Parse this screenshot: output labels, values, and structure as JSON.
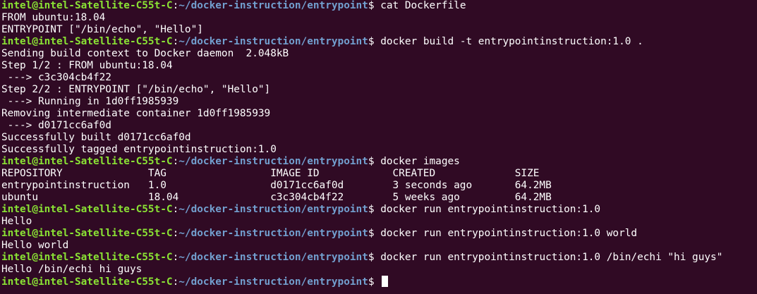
{
  "colors": {
    "background": "#300a24",
    "user_host": "#8ae234",
    "path": "#729fcf",
    "text": "#ffffff"
  },
  "prompt": {
    "user_host": "intel@intel-Satellite-C55t-C",
    "separator": ":",
    "path": "~/docker-instruction/entrypoint",
    "symbol": "$ "
  },
  "lines": [
    {
      "type": "prompt",
      "cmd": "cat Dockerfile"
    },
    {
      "type": "out",
      "text": "FROM ubuntu:18.04"
    },
    {
      "type": "out",
      "text": "ENTRYPOINT [\"/bin/echo\", \"Hello\"]"
    },
    {
      "type": "prompt",
      "cmd": "docker build -t entrypointinstruction:1.0 ."
    },
    {
      "type": "out",
      "text": "Sending build context to Docker daemon  2.048kB"
    },
    {
      "type": "out",
      "text": "Step 1/2 : FROM ubuntu:18.04"
    },
    {
      "type": "out",
      "text": " ---> c3c304cb4f22"
    },
    {
      "type": "out",
      "text": "Step 2/2 : ENTRYPOINT [\"/bin/echo\", \"Hello\"]"
    },
    {
      "type": "out",
      "text": " ---> Running in 1d0ff1985939"
    },
    {
      "type": "out",
      "text": "Removing intermediate container 1d0ff1985939"
    },
    {
      "type": "out",
      "text": " ---> d0171cc6af0d"
    },
    {
      "type": "out",
      "text": "Successfully built d0171cc6af0d"
    },
    {
      "type": "out",
      "text": "Successfully tagged entrypointinstruction:1.0"
    },
    {
      "type": "prompt",
      "cmd": "docker images"
    },
    {
      "type": "out",
      "text": "REPOSITORY              TAG                 IMAGE ID            CREATED             SIZE"
    },
    {
      "type": "out",
      "text": "entrypointinstruction   1.0                 d0171cc6af0d        3 seconds ago       64.2MB"
    },
    {
      "type": "out",
      "text": "ubuntu                  18.04               c3c304cb4f22        5 weeks ago         64.2MB"
    },
    {
      "type": "prompt",
      "cmd": "docker run entrypointinstruction:1.0"
    },
    {
      "type": "out",
      "text": "Hello"
    },
    {
      "type": "prompt",
      "cmd": "docker run entrypointinstruction:1.0 world"
    },
    {
      "type": "out",
      "text": "Hello world"
    },
    {
      "type": "prompt",
      "cmd": "docker run entrypointinstruction:1.0 /bin/echi \"hi guys\""
    },
    {
      "type": "out",
      "text": "Hello /bin/echi hi guys"
    },
    {
      "type": "prompt",
      "cmd": "",
      "cursor": true
    }
  ]
}
